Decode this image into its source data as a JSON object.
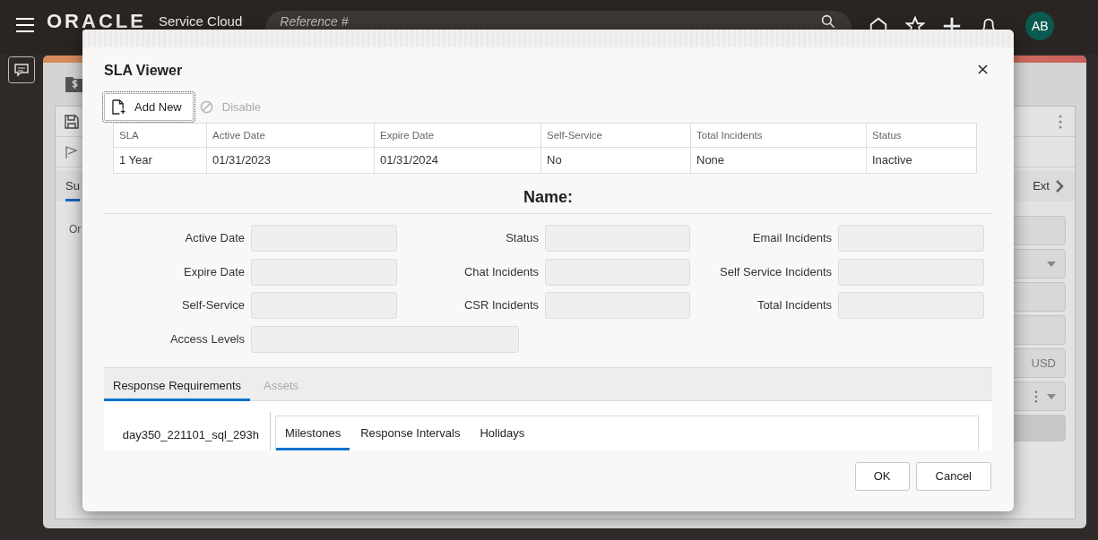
{
  "header": {
    "logo": "ORACLE",
    "product": "Service Cloud",
    "search": {
      "placeholder": "Reference #"
    },
    "avatar": "AB"
  },
  "background": {
    "tabs": [
      {
        "label": "Su",
        "selected": true
      },
      {
        "label": "Ext",
        "selected": false
      }
    ],
    "text": "Or",
    "currency": "USD"
  },
  "dialog": {
    "title": "SLA Viewer",
    "toolbar": [
      {
        "label": "Add New",
        "disabled": false
      },
      {
        "label": "Disable",
        "disabled": true
      }
    ],
    "table": {
      "columns": [
        "SLA",
        "Active Date",
        "Expire Date",
        "Self-Service",
        "Total Incidents",
        "Status"
      ],
      "rows": [
        [
          "1 Year",
          "01/31/2023",
          "01/31/2024",
          "No",
          "None",
          "Inactive"
        ]
      ]
    },
    "name_label": "Name:",
    "fields": [
      {
        "label": "Active Date",
        "kind": "short"
      },
      {
        "label": "Status",
        "kind": "short"
      },
      {
        "label": "Email Incidents",
        "kind": "short"
      },
      {
        "label": "Expire Date",
        "kind": "short"
      },
      {
        "label": "Chat Incidents",
        "kind": "short"
      },
      {
        "label": "Self Service Incidents",
        "kind": "short"
      },
      {
        "label": "Self-Service",
        "kind": "short"
      },
      {
        "label": "CSR Incidents",
        "kind": "short"
      },
      {
        "label": "Total Incidents",
        "kind": "short"
      },
      {
        "label": "Access Levels",
        "kind": "wide"
      }
    ],
    "tabs": [
      {
        "label": "Response Requirements",
        "selected": true,
        "disabled": false
      },
      {
        "label": "Assets",
        "selected": false,
        "disabled": true
      }
    ],
    "list": [
      "day350_221101_sql_293h"
    ],
    "inner_tabs": [
      {
        "label": "Milestones",
        "selected": true
      },
      {
        "label": "Response Intervals",
        "selected": false
      },
      {
        "label": "Holidays",
        "selected": false
      }
    ],
    "buttons": [
      "OK",
      "Cancel"
    ]
  }
}
